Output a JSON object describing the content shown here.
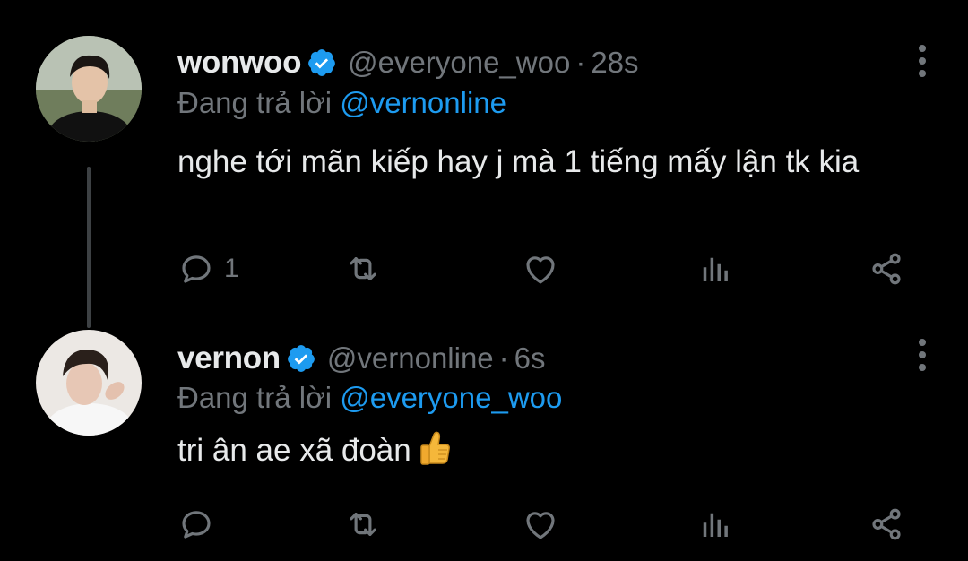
{
  "colors": {
    "background": "#000000",
    "primary_text": "#e7e9ea",
    "secondary_text": "#71767b",
    "link": "#1d9bf0",
    "verified": "#1d9bf0",
    "thread_line": "#3d4144"
  },
  "tweets": [
    {
      "name": "wonwoo",
      "handle": "@everyone_woo",
      "separator": "·",
      "time": "28s",
      "reply_prefix": "Đang trả lời",
      "reply_to": "@vernonline",
      "text": "nghe tới mãn kiếp hay j mà 1 tiếng mấy lận tk kia",
      "reply_count": "1",
      "icons": [
        "reply-icon",
        "retweet-icon",
        "like-icon",
        "views-icon",
        "share-icon",
        "more-icon",
        "verified-icon"
      ]
    },
    {
      "name": "vernon",
      "handle": "@vernonline",
      "separator": "·",
      "time": "6s",
      "reply_prefix": "Đang trả lời",
      "reply_to": "@everyone_woo",
      "text": "tri ân ae xã đoàn",
      "emoji": "thumbs-up",
      "reply_count": "",
      "icons": [
        "reply-icon",
        "retweet-icon",
        "like-icon",
        "views-icon",
        "share-icon",
        "more-icon",
        "verified-icon"
      ]
    }
  ]
}
